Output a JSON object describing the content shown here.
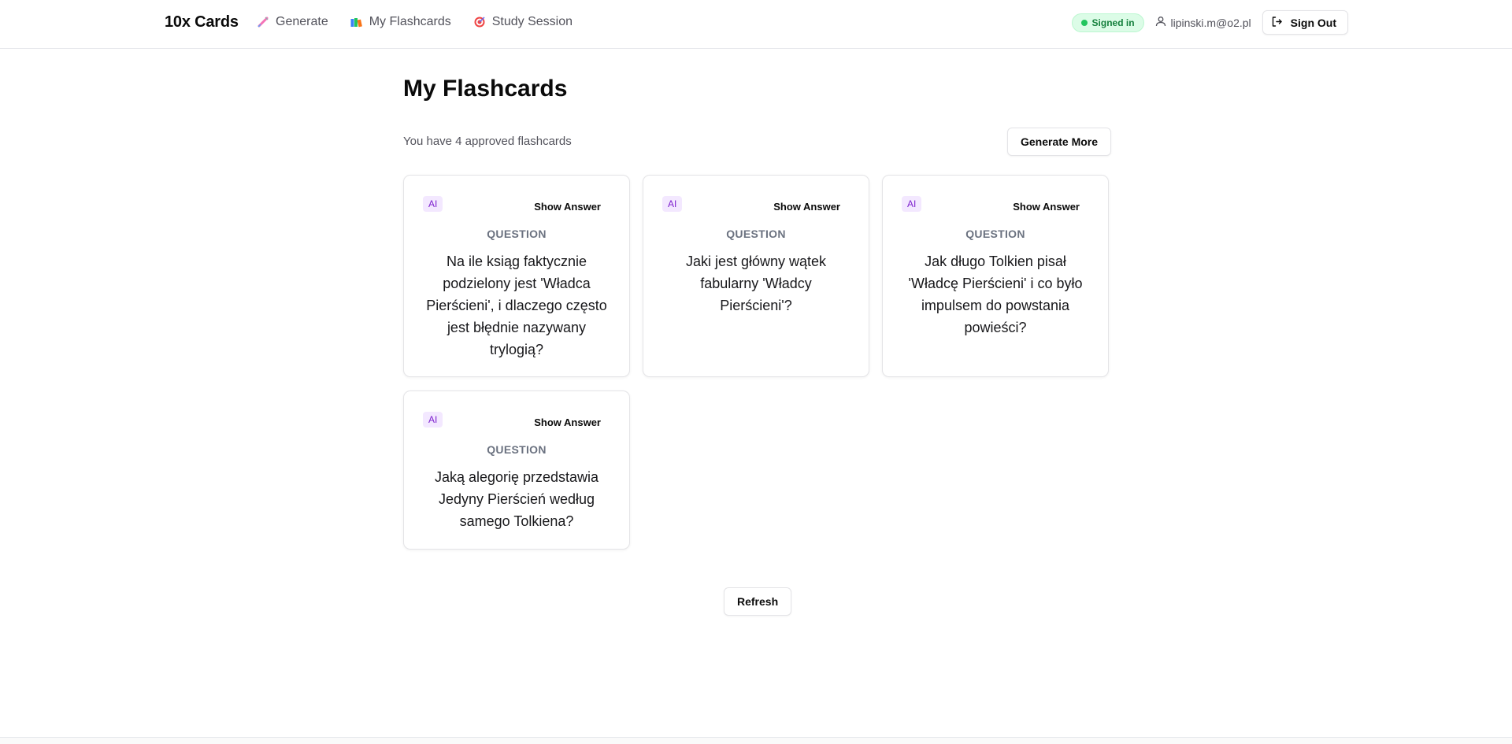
{
  "header": {
    "brand": "10x Cards",
    "nav": [
      {
        "label": "Generate",
        "icon": "syringe-icon"
      },
      {
        "label": "My Flashcards",
        "icon": "books-icon"
      },
      {
        "label": "Study Session",
        "icon": "target-icon"
      }
    ],
    "status_badge": "Signed in",
    "user_email": "lipinski.m@o2.pl",
    "sign_out_label": "Sign Out"
  },
  "main": {
    "title": "My Flashcards",
    "summary": "You have 4 approved flashcards",
    "generate_more_label": "Generate More",
    "refresh_label": "Refresh",
    "cards": [
      {
        "tag": "AI",
        "show_answer": "Show Answer",
        "label": "QUESTION",
        "question": "Na ile ksiąg faktycznie podzielony jest 'Władca Pierścieni', i dlaczego często jest błędnie nazywany trylogią?"
      },
      {
        "tag": "AI",
        "show_answer": "Show Answer",
        "label": "QUESTION",
        "question": "Jaki jest główny wątek fabularny 'Władcy Pierścieni'?"
      },
      {
        "tag": "AI",
        "show_answer": "Show Answer",
        "label": "QUESTION",
        "question": "Jak długo Tolkien pisał 'Władcę Pierścieni' i co było impulsem do powstania powieści?"
      },
      {
        "tag": "AI",
        "show_answer": "Show Answer",
        "label": "QUESTION",
        "question": "Jaką alegorię przedstawia Jedyny Pierścień według samego Tolkiena?"
      }
    ]
  },
  "colors": {
    "accent_green": "#22c55e",
    "ai_tag_bg": "#f3e8ff",
    "ai_tag_text": "#7e22ce"
  }
}
